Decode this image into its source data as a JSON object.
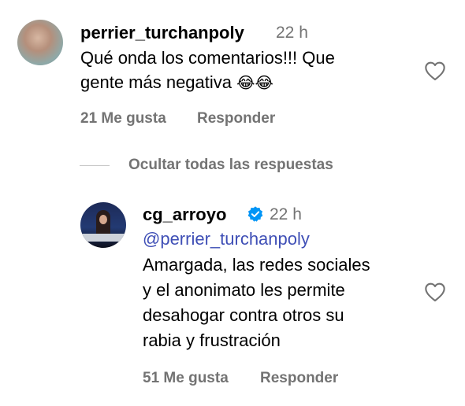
{
  "comment": {
    "username": "perrier_turchanpoly",
    "time": "22 h",
    "text_line1": "Qué onda los comentarios!!! Que",
    "text_line2": "gente más negativa",
    "emoji": "😂😂",
    "likes": "21 Me gusta",
    "reply_label": "Responder",
    "like_icon": "heart-outline"
  },
  "replies_toggle": {
    "label": "Ocultar todas las respuestas"
  },
  "reply": {
    "username": "cg_arroyo",
    "verified": true,
    "time": "22 h",
    "mention": "@perrier_turchanpoly",
    "lines": [
      "Amargada, las redes sociales",
      "y el anonimato les permite",
      "desahogar contra otros su",
      "rabia y frustración"
    ],
    "likes": "51 Me gusta",
    "reply_label": "Responder",
    "like_icon": "heart-outline"
  },
  "colors": {
    "secondary_text": "#737373",
    "mention": "#3f4fb6",
    "verified_badge": "#0095f6"
  }
}
